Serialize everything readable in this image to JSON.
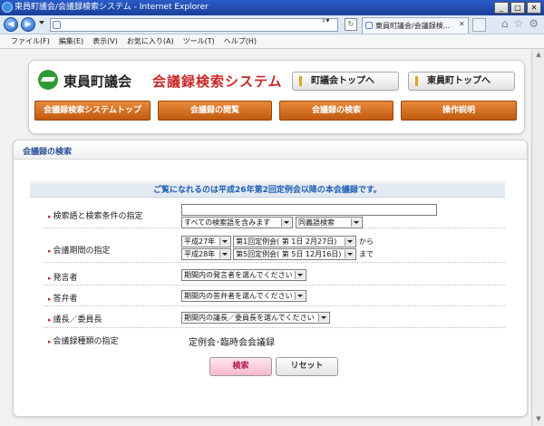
{
  "window": {
    "title": "東員町議会/会議録検索システム - Internet Explorer",
    "tab_title": "東員町議会/会議録検...",
    "menu": [
      "ファイル(F)",
      "編集(E)",
      "表示(V)",
      "お気に入り(A)",
      "ツール(T)",
      "ヘルプ(H)"
    ]
  },
  "header": {
    "site_name": "東員町議会",
    "system_name": "会議録検索システム",
    "top_links": [
      "町議会トップへ",
      "東員町トップへ"
    ],
    "nav": [
      "会議録検索システムトップ",
      "会議録の閲覧",
      "会議録の検索",
      "操作説明"
    ]
  },
  "search": {
    "heading": "会議録の検索",
    "notice": "ご覧になれるのは平成26年第2回定例会以降の本会議録です。",
    "keyword": {
      "label": "検索語と検索条件の指定",
      "value": "",
      "mode": "すべての検索語を含みます",
      "synonym": "同義語検索"
    },
    "period": {
      "label": "会議期間の指定",
      "from_year": "平成27年",
      "from_session": "第1回定例会( 第 1日  2月27日)",
      "from_suffix": "から",
      "to_year": "平成28年",
      "to_session": "第5回定例会( 第 5日 12月16日)",
      "to_suffix": "まで"
    },
    "speaker": {
      "label": "発言者",
      "value": "期間内の発言者を選んでください"
    },
    "respondent": {
      "label": "答弁者",
      "value": "期間内の答弁者を選んでください"
    },
    "chair": {
      "label": "議長／委員長",
      "value": "期間内の議長／委員長を選んでください"
    },
    "record_type": {
      "label": "会議録種類の指定",
      "value": "定例会･臨時会会議録"
    },
    "buttons": {
      "search": "検索",
      "reset": "リセット"
    }
  }
}
